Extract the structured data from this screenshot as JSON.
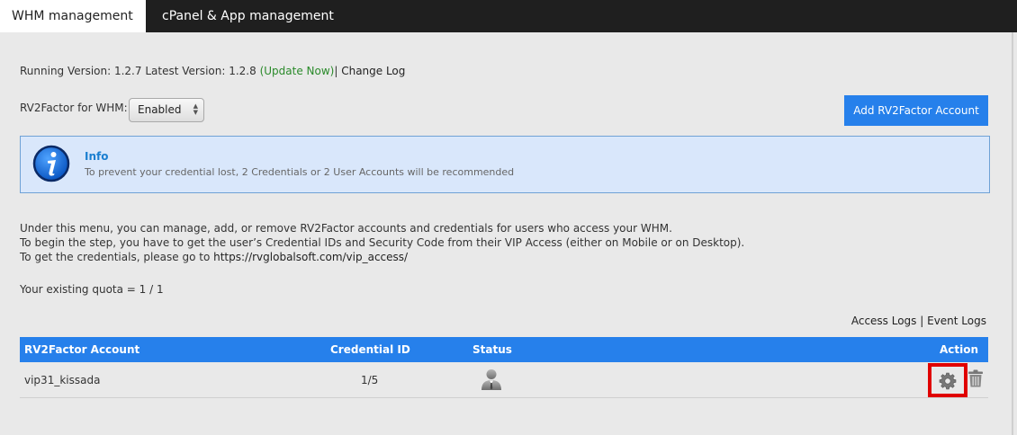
{
  "tabs": [
    {
      "label": "WHM management",
      "active": true
    },
    {
      "label": "cPanel & App management",
      "active": false
    }
  ],
  "version": {
    "prefix": "Running Version: 1.2.7 Latest Version: 1.2.8 ",
    "update_link": "(Update Now)",
    "separator": "| ",
    "changelog_link": "Change Log"
  },
  "rv2factor": {
    "label": "RV2Factor for WHM:",
    "selected": "Enabled"
  },
  "add_button": "Add RV2Factor Account",
  "info": {
    "title": "Info",
    "text": "To prevent your credential lost, 2 Credentials or 2 User Accounts will be recommended"
  },
  "description": {
    "line1": "Under this menu, you can manage, add, or remove RV2Factor accounts and credentials for users who access your WHM.",
    "line2": "To begin the step, you have to get the user’s Credential IDs and Security Code from their VIP Access (either on Mobile or on Desktop).",
    "line3_prefix": "To get the credentials, please go to ",
    "line3_link": "https://rvglobalsoft.com/vip_access/"
  },
  "quota": "Your existing quota = 1 / 1",
  "logs": {
    "access": "Access Logs",
    "separator": " | ",
    "event": "Event Logs"
  },
  "table": {
    "headers": {
      "account": "RV2Factor Account",
      "credential": "Credential ID",
      "status": "Status",
      "action": "Action"
    },
    "rows": [
      {
        "account": "vip31_kissada",
        "credential": "1/5",
        "status_icon": "user-icon"
      }
    ]
  },
  "colors": {
    "accent": "#2680eb",
    "highlight": "#e00000",
    "update_link": "#2a8a2a"
  }
}
